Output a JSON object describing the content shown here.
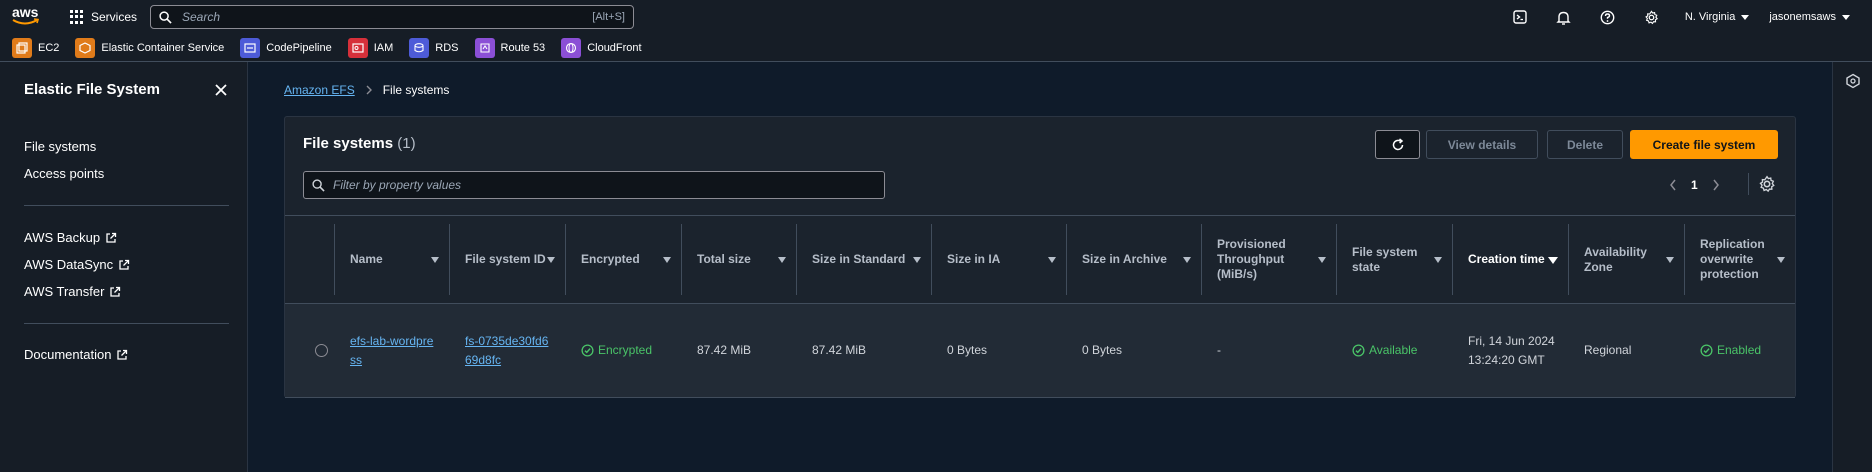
{
  "topnav": {
    "logo_text": "aws",
    "services_label": "Services",
    "search_placeholder": "Search",
    "search_shortcut": "[Alt+S]",
    "region": "N. Virginia",
    "account": "jasonemsaws"
  },
  "favorites": [
    {
      "label": "EC2",
      "color": "#e07b1a",
      "icon": "ec2-icon"
    },
    {
      "label": "Elastic Container Service",
      "color": "#e07b1a",
      "icon": "ecs-icon"
    },
    {
      "label": "CodePipeline",
      "color": "#4d5bd8",
      "icon": "codepipeline-icon"
    },
    {
      "label": "IAM",
      "color": "#d6303a",
      "icon": "iam-icon"
    },
    {
      "label": "RDS",
      "color": "#4d5bd8",
      "icon": "rds-icon"
    },
    {
      "label": "Route 53",
      "color": "#8b4fd6",
      "icon": "route53-icon"
    },
    {
      "label": "CloudFront",
      "color": "#8b4fd6",
      "icon": "cloudfront-icon"
    }
  ],
  "sidebar": {
    "title": "Elastic File System",
    "items": [
      "File systems",
      "Access points"
    ],
    "external": [
      "AWS Backup",
      "AWS DataSync",
      "AWS Transfer"
    ],
    "docs": "Documentation"
  },
  "breadcrumb": {
    "parent": "Amazon EFS",
    "current": "File systems"
  },
  "panel": {
    "title": "File systems",
    "count": "(1)",
    "view_details": "View details",
    "delete": "Delete",
    "create": "Create file system",
    "filter_placeholder": "Filter by property values",
    "page": "1"
  },
  "table": {
    "columns": [
      "Name",
      "File system ID",
      "Encrypted",
      "Total size",
      "Size in Standard",
      "Size in IA",
      "Size in Archive",
      "Provisioned Throughput (MiB/s)",
      "File system state",
      "Creation time",
      "Availability Zone",
      "Replication overwrite protection"
    ],
    "row": {
      "name": "efs-lab-wordpress",
      "id": "fs-0735de30fd669d8fc",
      "encrypted": "Encrypted",
      "total_size": "87.42 MiB",
      "size_standard": "87.42 MiB",
      "size_ia": "0 Bytes",
      "size_archive": "0 Bytes",
      "throughput": "-",
      "state": "Available",
      "creation": "Fri, 14 Jun 2024 13:24:20 GMT",
      "az": "Regional",
      "replication": "Enabled"
    }
  },
  "colors": {
    "accent": "#ff9900",
    "link": "#66b5f2",
    "success": "#4ac468"
  }
}
